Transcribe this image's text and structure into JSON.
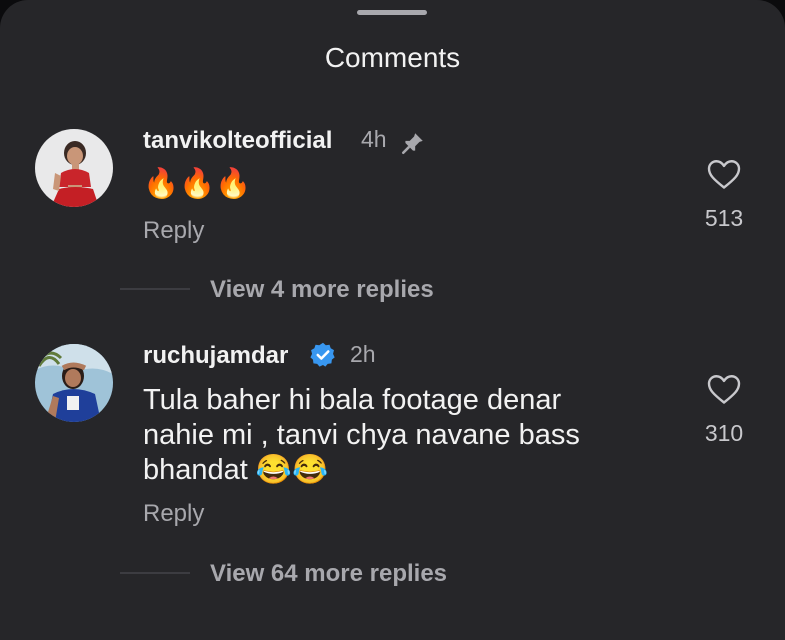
{
  "sheet": {
    "title": "Comments"
  },
  "comments": [
    {
      "username": "tanvikolteofficial",
      "time": "4h",
      "pinned": true,
      "text": "🔥🔥🔥",
      "reply_label": "Reply",
      "likes": "513",
      "view_more": "View 4 more replies"
    },
    {
      "username": "ruchujamdar",
      "verified": true,
      "time": "2h",
      "text_lines": [
        "Tula baher hi bala footage denar",
        "nahie mi , tanvi chya navane bass",
        "bhandat 😂😂"
      ],
      "reply_label": "Reply",
      "likes": "310",
      "view_more": "View 64 more replies"
    }
  ],
  "colors": {
    "background": "#262629",
    "muted": "#a8a8ad",
    "verified": "#3897f0"
  },
  "icons": [
    "pin-icon",
    "verified-badge-icon",
    "heart-icon",
    "fire-emoji",
    "laughing-tears-emoji"
  ]
}
